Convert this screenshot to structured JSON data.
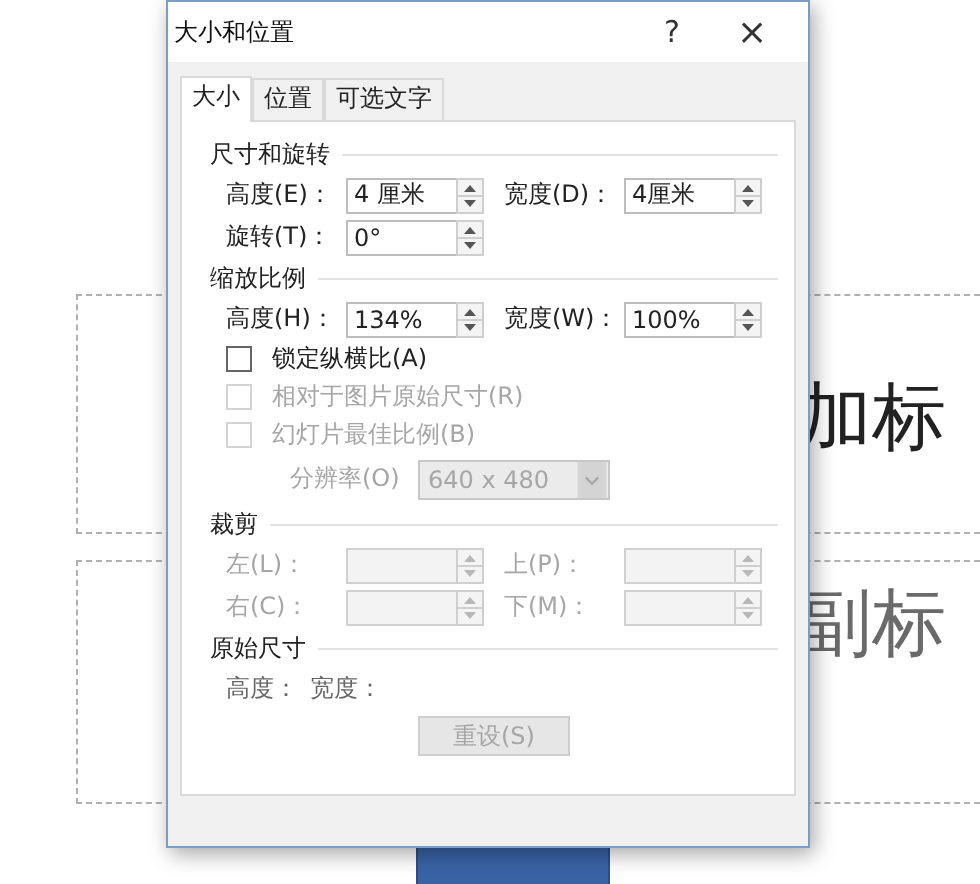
{
  "slide": {
    "placeholders": [
      {
        "text": "加标"
      },
      {
        "text": "副标"
      }
    ]
  },
  "dialog": {
    "title": "大小和位置",
    "help": "?",
    "close": "×",
    "tabs": [
      {
        "label": "大小",
        "selected": true
      },
      {
        "label": "位置",
        "selected": false
      },
      {
        "label": "可选文字",
        "selected": false
      }
    ],
    "sections": [
      {
        "title": "尺寸和旋转",
        "rows": [
          {
            "kind": "fields",
            "fields": [
              {
                "label": "高度(E)：",
                "value": "4 厘米",
                "disabled": false
              },
              {
                "label": "宽度(D)：",
                "value": "4厘米",
                "disabled": false
              }
            ]
          },
          {
            "kind": "fields",
            "fields": [
              {
                "label": "旋转(T)：",
                "value": "0°",
                "disabled": false
              }
            ]
          }
        ]
      },
      {
        "title": "缩放比例",
        "rows": [
          {
            "kind": "fields",
            "fields": [
              {
                "label": "高度(H)：",
                "value": "134%",
                "disabled": false
              },
              {
                "label": "宽度(W)：",
                "value": "100%",
                "disabled": false
              }
            ]
          },
          {
            "kind": "checkbox",
            "label": "锁定纵横比(A)",
            "checked": false,
            "disabled": false
          },
          {
            "kind": "checkbox",
            "label": "相对于图片原始尺寸(R)",
            "checked": false,
            "disabled": true
          },
          {
            "kind": "checkbox",
            "label": "幻灯片最佳比例(B)",
            "checked": false,
            "disabled": true
          },
          {
            "kind": "combo",
            "label": "分辨率(O)",
            "value": "640 x 480",
            "disabled": true
          }
        ]
      },
      {
        "title": "裁剪",
        "rows": [
          {
            "kind": "fields",
            "fields": [
              {
                "label": "左(L)：",
                "disabled": true
              },
              {
                "label": "上(P)：",
                "disabled": true
              }
            ]
          },
          {
            "kind": "fields",
            "fields": [
              {
                "label": "右(C)：",
                "disabled": true
              },
              {
                "label": "下(M)：",
                "disabled": true
              }
            ]
          }
        ]
      },
      {
        "title": "原始尺寸",
        "rows": [
          {
            "kind": "labels",
            "labels": [
              "高度：",
              "宽度："
            ]
          },
          {
            "kind": "button",
            "label": "重设(S)",
            "disabled": true
          }
        ]
      }
    ]
  }
}
